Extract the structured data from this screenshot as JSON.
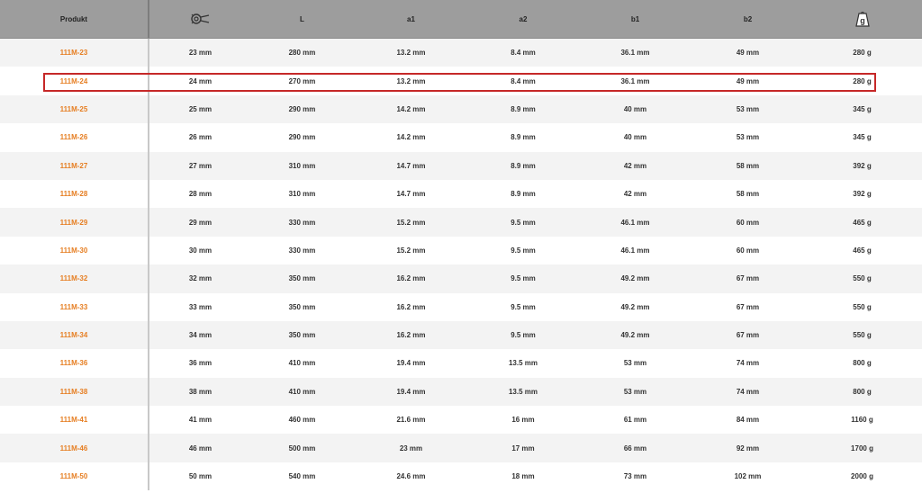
{
  "columns": {
    "product": "Produkt",
    "size_icon": "wrench-size-icon",
    "L": "L",
    "a1": "a1",
    "a2": "a2",
    "b1": "b1",
    "b2": "b2",
    "weight_icon": "weight-icon",
    "weight_icon_text": "g"
  },
  "colors": {
    "product_accent": "#e67e22",
    "highlight_border": "#c62828",
    "header_bg": "#9d9d9d"
  },
  "highlighted_row": "111M-24",
  "rows": [
    {
      "product": "111M-23",
      "size": "23 mm",
      "L": "280 mm",
      "a1": "13.2 mm",
      "a2": "8.4 mm",
      "b1": "36.1 mm",
      "b2": "49 mm",
      "weight": "280 g"
    },
    {
      "product": "111M-24",
      "size": "24 mm",
      "L": "270 mm",
      "a1": "13.2 mm",
      "a2": "8.4 mm",
      "b1": "36.1 mm",
      "b2": "49 mm",
      "weight": "280 g"
    },
    {
      "product": "111M-25",
      "size": "25 mm",
      "L": "290 mm",
      "a1": "14.2 mm",
      "a2": "8.9 mm",
      "b1": "40 mm",
      "b2": "53 mm",
      "weight": "345 g"
    },
    {
      "product": "111M-26",
      "size": "26 mm",
      "L": "290 mm",
      "a1": "14.2 mm",
      "a2": "8.9 mm",
      "b1": "40 mm",
      "b2": "53 mm",
      "weight": "345 g"
    },
    {
      "product": "111M-27",
      "size": "27 mm",
      "L": "310 mm",
      "a1": "14.7 mm",
      "a2": "8.9 mm",
      "b1": "42 mm",
      "b2": "58 mm",
      "weight": "392 g"
    },
    {
      "product": "111M-28",
      "size": "28 mm",
      "L": "310 mm",
      "a1": "14.7 mm",
      "a2": "8.9 mm",
      "b1": "42 mm",
      "b2": "58 mm",
      "weight": "392 g"
    },
    {
      "product": "111M-29",
      "size": "29 mm",
      "L": "330 mm",
      "a1": "15.2 mm",
      "a2": "9.5 mm",
      "b1": "46.1 mm",
      "b2": "60 mm",
      "weight": "465 g"
    },
    {
      "product": "111M-30",
      "size": "30 mm",
      "L": "330 mm",
      "a1": "15.2 mm",
      "a2": "9.5 mm",
      "b1": "46.1 mm",
      "b2": "60 mm",
      "weight": "465 g"
    },
    {
      "product": "111M-32",
      "size": "32 mm",
      "L": "350 mm",
      "a1": "16.2 mm",
      "a2": "9.5 mm",
      "b1": "49.2 mm",
      "b2": "67 mm",
      "weight": "550 g"
    },
    {
      "product": "111M-33",
      "size": "33 mm",
      "L": "350 mm",
      "a1": "16.2 mm",
      "a2": "9.5 mm",
      "b1": "49.2 mm",
      "b2": "67 mm",
      "weight": "550 g"
    },
    {
      "product": "111M-34",
      "size": "34 mm",
      "L": "350 mm",
      "a1": "16.2 mm",
      "a2": "9.5 mm",
      "b1": "49.2 mm",
      "b2": "67 mm",
      "weight": "550 g"
    },
    {
      "product": "111M-36",
      "size": "36 mm",
      "L": "410 mm",
      "a1": "19.4 mm",
      "a2": "13.5 mm",
      "b1": "53 mm",
      "b2": "74 mm",
      "weight": "800 g"
    },
    {
      "product": "111M-38",
      "size": "38 mm",
      "L": "410 mm",
      "a1": "19.4 mm",
      "a2": "13.5 mm",
      "b1": "53 mm",
      "b2": "74 mm",
      "weight": "800 g"
    },
    {
      "product": "111M-41",
      "size": "41 mm",
      "L": "460 mm",
      "a1": "21.6 mm",
      "a2": "16 mm",
      "b1": "61 mm",
      "b2": "84 mm",
      "weight": "1160 g"
    },
    {
      "product": "111M-46",
      "size": "46 mm",
      "L": "500 mm",
      "a1": "23 mm",
      "a2": "17 mm",
      "b1": "66 mm",
      "b2": "92 mm",
      "weight": "1700 g"
    },
    {
      "product": "111M-50",
      "size": "50 mm",
      "L": "540 mm",
      "a1": "24.6 mm",
      "a2": "18 mm",
      "b1": "73 mm",
      "b2": "102 mm",
      "weight": "2000 g"
    }
  ]
}
